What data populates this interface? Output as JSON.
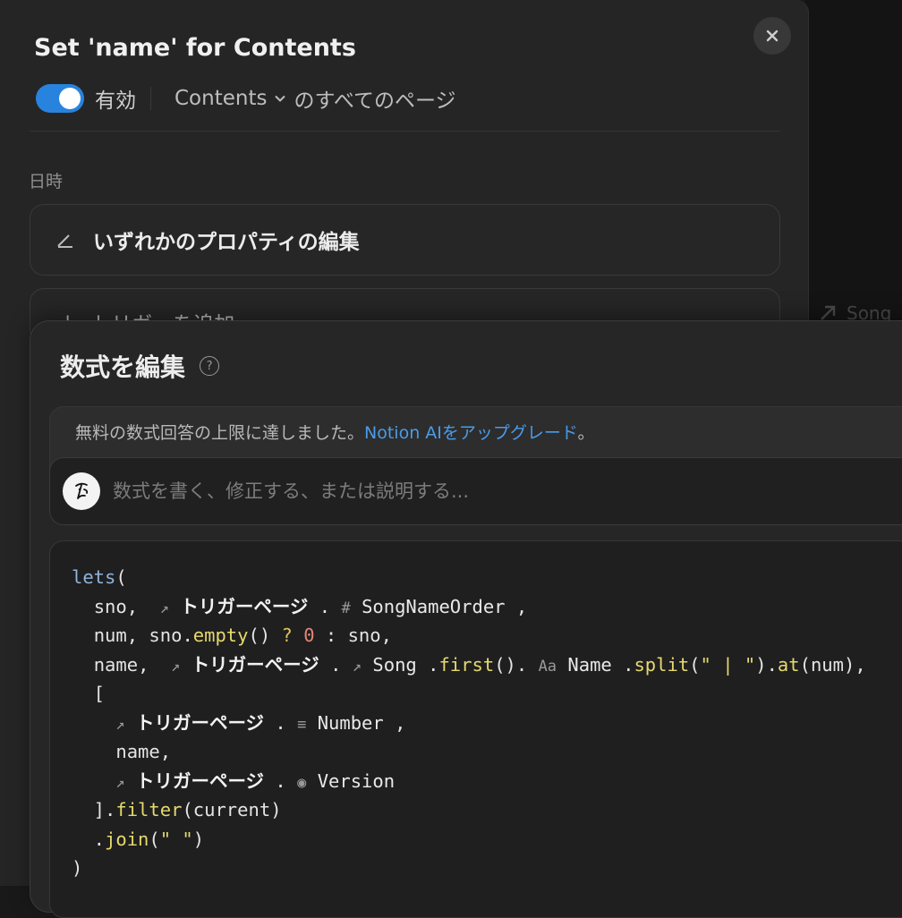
{
  "panel": {
    "title": "Set 'name' for Contents",
    "toggle_label": "有効",
    "toggle_on": true,
    "database": "Contents",
    "scope_text": "のすべてのページ",
    "section_label": "日時",
    "trigger_label": "いずれかのプロパティの編集",
    "add_trigger_label": "トリガーを追加"
  },
  "background": {
    "peek_text": "Song"
  },
  "editor": {
    "title": "数式を編集",
    "ai_limit_text": "無料の数式回答の上限に達しました。",
    "ai_upgrade_link": "Notion AIをアップグレード",
    "ai_limit_end": "。",
    "ai_input_placeholder": "数式を書く、修正する、または説明する...",
    "code": {
      "lets": "lets",
      "trigger_page": "トリガーページ",
      "var_sno": "sno",
      "var_num": "num",
      "var_name": "name",
      "prop_songnameorder": "SongNameOrder",
      "prop_song": "Song",
      "prop_name": "Name",
      "prop_number": "Number",
      "prop_version": "Version",
      "fn_empty": "empty",
      "fn_first": "first",
      "fn_split": "split",
      "fn_at": "at",
      "fn_filter": "filter",
      "fn_join": "join",
      "str_split": "\" | \"",
      "str_join": "\" \"",
      "num_zero": "0",
      "current": "current"
    }
  },
  "colors": {
    "accent": "#2783de",
    "link": "#4a9bea",
    "keyword": "#8fb4dc",
    "function": "#e6d96e",
    "number": "#e2857a"
  }
}
